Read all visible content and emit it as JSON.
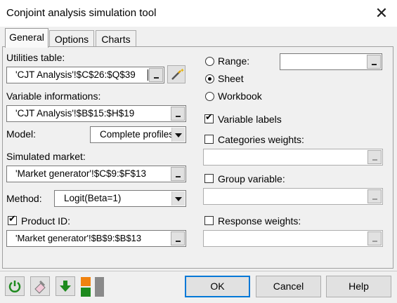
{
  "window": {
    "title": "Conjoint analysis simulation tool"
  },
  "tabs": [
    {
      "label": "General",
      "active": true
    },
    {
      "label": "Options",
      "active": false
    },
    {
      "label": "Charts",
      "active": false
    }
  ],
  "left": {
    "utilities_label": "Utilities table:",
    "utilities_value": "'CJT Analysis'!$C$26:$Q$39",
    "varinfo_label": "Variable informations:",
    "varinfo_value": "'CJT Analysis'!$B$15:$H$19",
    "model_label": "Model:",
    "model_value": "Complete profiles",
    "market_label": "Simulated market:",
    "market_value": "'Market generator'!$C$9:$F$13",
    "method_label": "Method:",
    "method_value": "Logit(Beta=1)",
    "productid_label": "Product ID:",
    "productid_checked": true,
    "productid_value": "'Market generator'!$B$9:$B$13"
  },
  "right": {
    "range_label": "Range:",
    "sheet_label": "Sheet",
    "workbook_label": "Workbook",
    "selected_output": "Sheet",
    "variable_labels_label": "Variable labels",
    "variable_labels_checked": true,
    "categories_weights_label": "Categories weights:",
    "categories_weights_checked": false,
    "group_variable_label": "Group variable:",
    "group_variable_checked": false,
    "response_weights_label": "Response weights:",
    "response_weights_checked": false
  },
  "buttons": {
    "ok": "OK",
    "cancel": "Cancel",
    "help": "Help"
  },
  "toolbar_icons": [
    "refresh-icon",
    "eraser-icon",
    "down-arrow-icon",
    "layout-toggle-icon"
  ],
  "colors": {
    "accent": "#0078d7",
    "green": "#1e8a1e",
    "orange": "#f0820f"
  }
}
